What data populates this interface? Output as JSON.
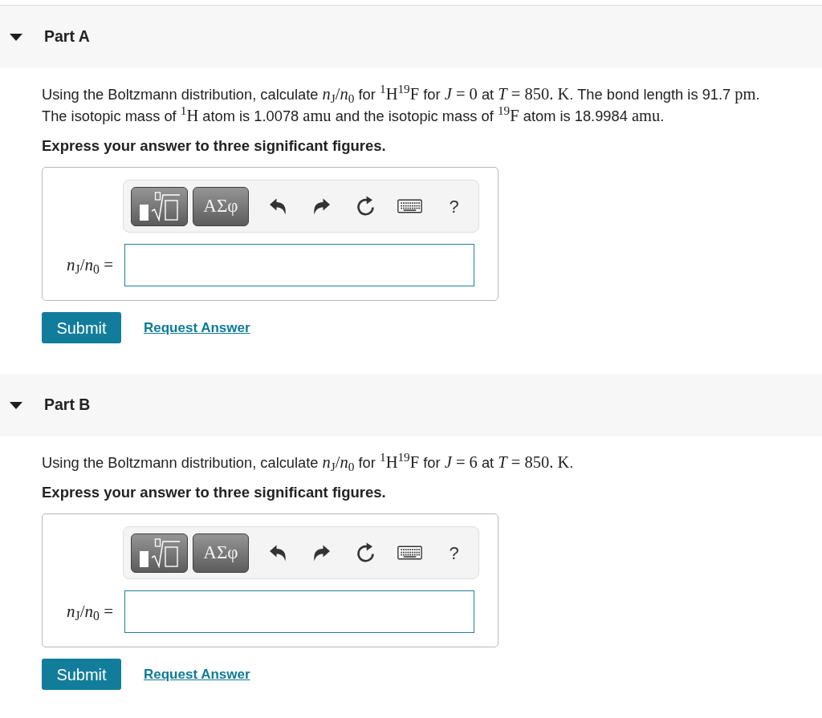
{
  "parts": [
    {
      "title": "Part A",
      "expanded": true,
      "question": [
        {
          "kind": "text",
          "text": "Using the Boltzmann distribution, calculate "
        },
        {
          "kind": "math",
          "text": "*n*$_{J}$/*n*$_{0}$"
        },
        {
          "kind": "text",
          "text": " for "
        },
        {
          "kind": "math",
          "text": "$^{1}$H$^{19}$F"
        },
        {
          "kind": "text",
          "text": " for "
        },
        {
          "kind": "math",
          "text": "*J* = 0"
        },
        {
          "kind": "text",
          "text": " at "
        },
        {
          "kind": "math",
          "text": "*T* = 850. K"
        },
        {
          "kind": "text",
          "text": ". The bond length is 91.7 "
        },
        {
          "kind": "math",
          "text": "pm"
        },
        {
          "kind": "text",
          "text": ". The isotopic mass of "
        },
        {
          "kind": "math",
          "text": "$^{1}$H"
        },
        {
          "kind": "text",
          "text": " atom is 1.0078 "
        },
        {
          "kind": "math",
          "text": "amu"
        },
        {
          "kind": "text",
          "text": " and the isotopic mass of "
        },
        {
          "kind": "math",
          "text": "$^{19}$F"
        },
        {
          "kind": "text",
          "text": " atom is 18.9984 "
        },
        {
          "kind": "math",
          "text": "amu"
        },
        {
          "kind": "text",
          "text": "."
        }
      ],
      "instruction": "Express your answer to three significant figures.",
      "answer": {
        "label": "*n*$_{J}$/*n*$_{0}$ ="
      },
      "toolbar": {
        "symbols_label": "ΑΣφ",
        "help_label": "?"
      },
      "submit": "Submit",
      "request_answer": "Request Answer"
    },
    {
      "title": "Part B",
      "expanded": true,
      "question": [
        {
          "kind": "text",
          "text": "Using the Boltzmann distribution, calculate "
        },
        {
          "kind": "math",
          "text": "*n*$_{J}$/*n*$_{0}$"
        },
        {
          "kind": "text",
          "text": " for "
        },
        {
          "kind": "math",
          "text": "$^{1}$H$^{19}$F"
        },
        {
          "kind": "text",
          "text": " for "
        },
        {
          "kind": "math",
          "text": "*J* = 6"
        },
        {
          "kind": "text",
          "text": " at "
        },
        {
          "kind": "math",
          "text": "*T* = 850. K"
        },
        {
          "kind": "text",
          "text": "."
        }
      ],
      "instruction": "Express your answer to three significant figures.",
      "answer": {
        "label": "*n*$_{J}$/*n*$_{0}$ ="
      },
      "toolbar": {
        "symbols_label": "ΑΣφ",
        "help_label": "?"
      },
      "submit": "Submit",
      "request_answer": "Request Answer"
    }
  ]
}
